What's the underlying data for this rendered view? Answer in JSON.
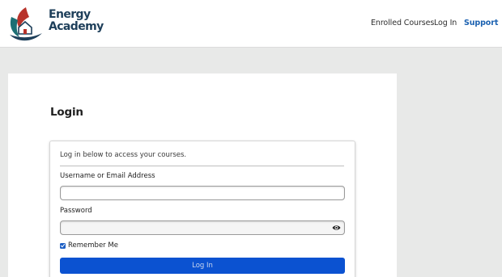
{
  "brand": {
    "line1": "Energy",
    "line2": "Academy",
    "colors": {
      "text": "#1e3f5a",
      "leaf_red": "#b8332b",
      "leaf_teal": "#1d6f74",
      "swoosh_navy": "#1e3f5a"
    }
  },
  "nav": {
    "enrolled_courses": "Enrolled Courses",
    "log_in": "Log In",
    "support": "Support"
  },
  "page": {
    "title": "Login"
  },
  "form": {
    "intro": "Log in below to access your courses.",
    "username_label": "Username or Email Address",
    "username_value": "",
    "password_label": "Password",
    "password_value": "",
    "password_toggle_icon": "eye-icon",
    "remember_label": "Remember Me",
    "remember_checked": true,
    "submit_label": "Log In"
  },
  "colors": {
    "accent": "#0b52d1",
    "link": "#1c62b1",
    "background": "#e8e9e8"
  }
}
